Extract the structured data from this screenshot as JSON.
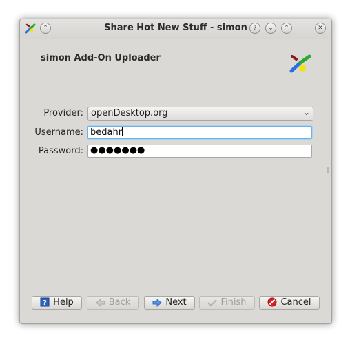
{
  "window": {
    "title": "Share Hot New Stuff - simon",
    "help_glyph": "?",
    "minimize_glyph": "⌄",
    "maximize_glyph": "⌃",
    "close_glyph": "✕",
    "shade_glyph": "⌃"
  },
  "header": {
    "title": "simon Add-On Uploader",
    "logo_icon": "simon-logo-icon"
  },
  "form": {
    "provider_label": "Provider:",
    "provider_value": "openDesktop.org",
    "username_label": "Username:",
    "username_value": "bedahr",
    "password_label": "Password:",
    "password_mask": "●●●●●●●"
  },
  "buttons": {
    "help": "Help",
    "back": "Back",
    "next": "Next",
    "finish": "Finish",
    "cancel": "Cancel"
  },
  "colors": {
    "window_bg": "#dad9d6",
    "focus": "#6fb0e8",
    "cancel_red": "#d8201e",
    "next_blue": "#2f6fc3"
  }
}
